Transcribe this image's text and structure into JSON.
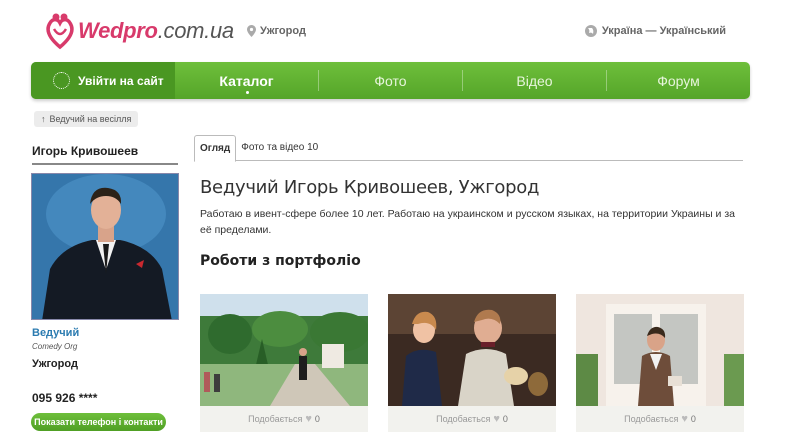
{
  "header": {
    "logo_brand": "Wedpro",
    "logo_tld": ".com.ua",
    "city": "Ужгород",
    "language": "Україна — Український"
  },
  "nav": {
    "login": "Увійти на сайт",
    "items": [
      "Каталог",
      "Фото",
      "Відео",
      "Форум"
    ],
    "active": "Каталог"
  },
  "breadcrumb": {
    "label": "Ведучий на весілля"
  },
  "sidebar": {
    "name": "Игорь Кривошеев",
    "role": "Ведучий",
    "org": "Comedy Org",
    "city": "Ужгород",
    "phone": "095 926 ****",
    "show_button": "Показати телефон і контакти"
  },
  "tabs": [
    "Огляд",
    "Фото та відео 10"
  ],
  "main": {
    "heading": "Ведучий Игорь Кривошеев, Ужгород",
    "description": "Работаю в ивент-сфере более 10 лет. Работаю на украинском и русском языках, на территории Украины и за её пределами.",
    "portfolio_title": "Роботи з портфоліо",
    "cards": [
      {
        "likes_label": "Подобається",
        "likes_count": "0"
      },
      {
        "likes_label": "Подобається",
        "likes_count": "0"
      },
      {
        "likes_label": "Подобається",
        "likes_count": "0"
      }
    ]
  },
  "colors": {
    "brand_pink": "#d83a6b",
    "nav_green": "#62b333",
    "link_blue": "#2b7bb0"
  }
}
